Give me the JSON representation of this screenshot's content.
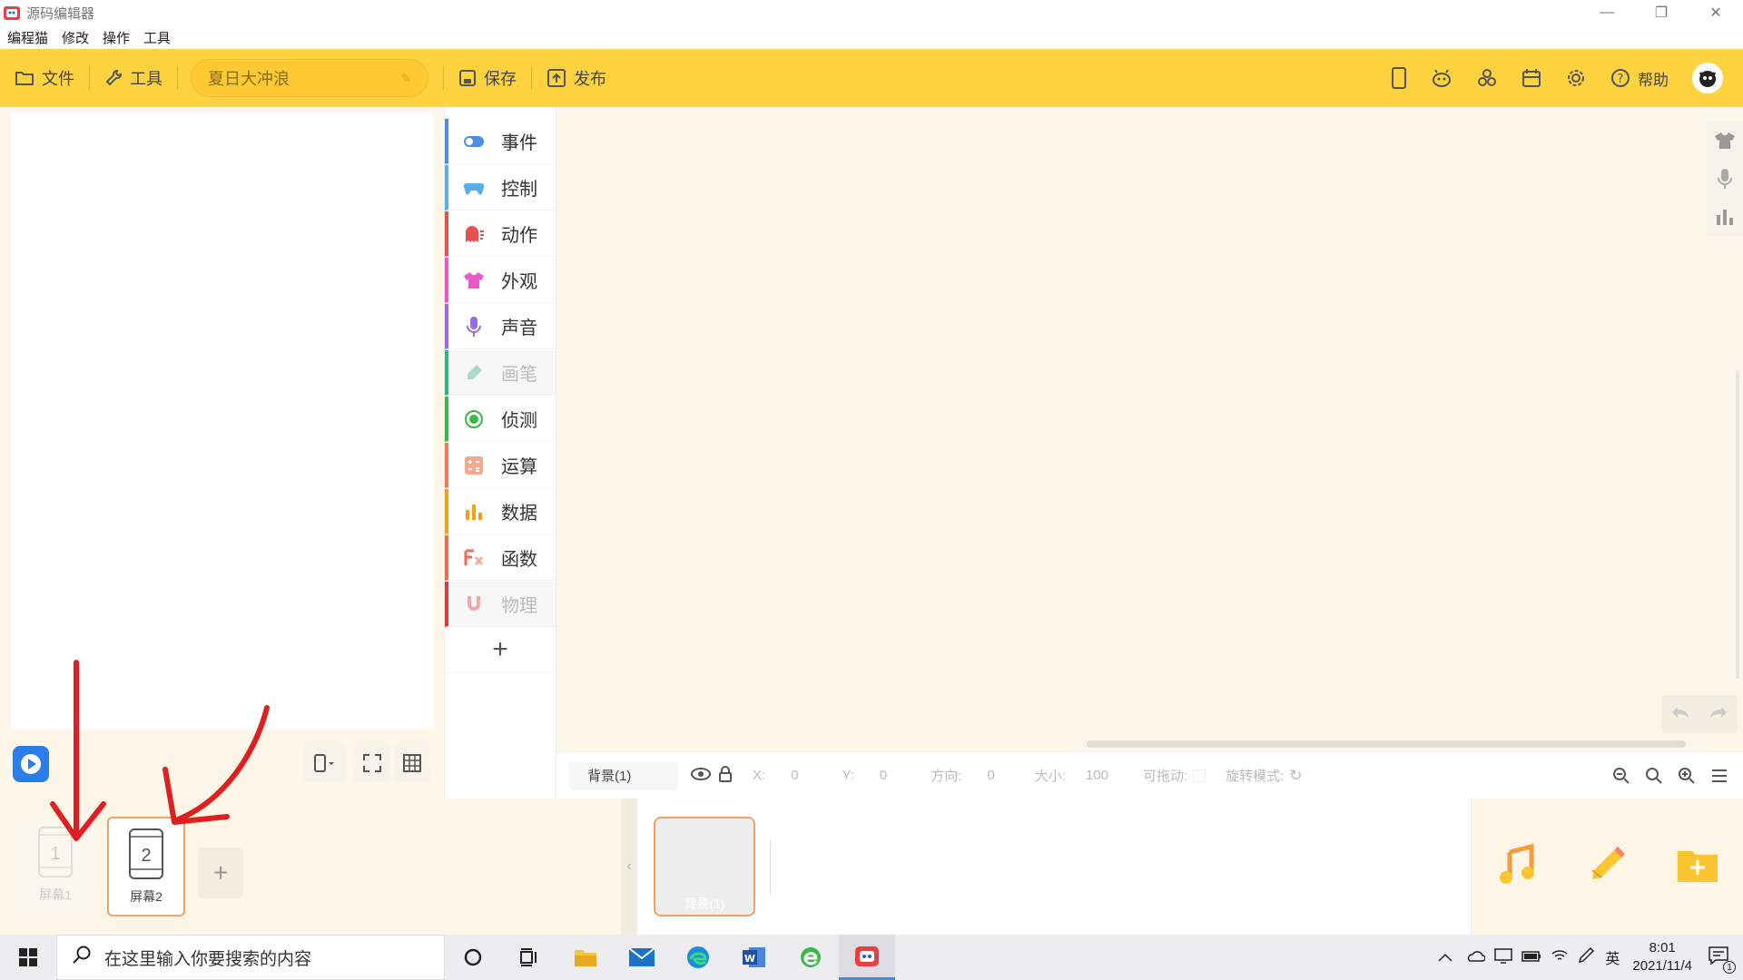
{
  "window": {
    "title": "源码编辑器",
    "controls": [
      "minimize",
      "restore",
      "close"
    ]
  },
  "menu": [
    "编程猫",
    "修改",
    "操作",
    "工具"
  ],
  "toolbar": {
    "file": "文件",
    "tools": "工具",
    "project_name": "夏日大冲浪",
    "save": "保存",
    "publish": "发布",
    "help": "帮助",
    "icons": [
      "phone-icon",
      "robot-icon",
      "cluster-icon",
      "calendar-icon",
      "gear-icon",
      "help-icon"
    ]
  },
  "categories": [
    {
      "label": "事件",
      "color": "#4a90e8",
      "icon": "toggle-icon"
    },
    {
      "label": "控制",
      "color": "#5aaee8",
      "icon": "gamepad-icon"
    },
    {
      "label": "动作",
      "color": "#e85050",
      "icon": "ghost-icon"
    },
    {
      "label": "外观",
      "color": "#e858c8",
      "icon": "shirt-icon"
    },
    {
      "label": "声音",
      "color": "#9a6be8",
      "icon": "mic-icon"
    },
    {
      "label": "画笔",
      "color": "#2fb48a",
      "icon": "pen-icon"
    },
    {
      "label": "侦测",
      "color": "#3cb84a",
      "icon": "radar-icon"
    },
    {
      "label": "运算",
      "color": "#f07a5a",
      "icon": "calc-icon"
    },
    {
      "label": "数据",
      "color": "#f0a020",
      "icon": "chart-icon"
    },
    {
      "label": "函数",
      "color": "#f06a5a",
      "icon": "function-icon"
    },
    {
      "label": "物理",
      "color": "#d04040",
      "icon": "magnet-icon"
    }
  ],
  "props": {
    "object": "背景(1)",
    "x_label": "X:",
    "x": "0",
    "y_label": "Y:",
    "y": "0",
    "dir_label": "方向:",
    "dir": "0",
    "size_label": "大小:",
    "size": "100",
    "drag_label": "可拖动:",
    "rotate_label": "旋转模式:"
  },
  "screens": [
    {
      "num": "1",
      "label": "屏幕1"
    },
    {
      "num": "2",
      "label": "屏幕2"
    }
  ],
  "backgrounds": [
    {
      "label": "背景(1)"
    }
  ],
  "taskbar": {
    "search_placeholder": "在这里输入你要搜索的内容",
    "ime": "英",
    "time": "8:01",
    "date": "2021/11/4",
    "notify_count": "1"
  },
  "colors": {
    "toolbar": "#fed33f",
    "accent_orange": "#f5a064",
    "annotation_red": "#e02020"
  }
}
